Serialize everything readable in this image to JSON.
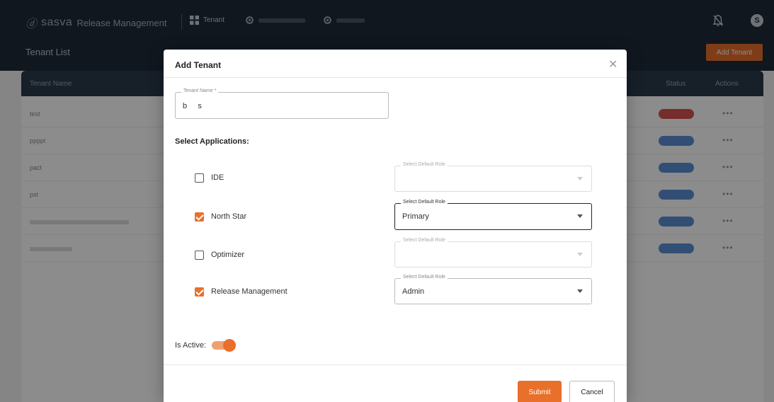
{
  "nav": {
    "brand_logo": "ⓓ",
    "brand_name": "sasva",
    "brand_product": "Release Management",
    "tabs": [
      {
        "label": "Tenant",
        "icon": "grid-icon"
      },
      {
        "label": "",
        "icon": "gear-icon"
      },
      {
        "label": "",
        "icon": "gear-icon"
      }
    ],
    "bell_icon": "bell-off-icon",
    "avatar_initial": "S"
  },
  "page": {
    "title": "Tenant List",
    "add_button": "Add Tenant"
  },
  "table": {
    "columns": [
      "Tenant Name",
      "Status",
      "Actions"
    ],
    "rows": [
      {
        "name": "test",
        "status": "",
        "status_color": "#d9534f"
      },
      {
        "name": "ppppl",
        "status": "",
        "status_color": "#5b8fd6"
      },
      {
        "name": "pact",
        "status": "",
        "status_color": "#5b8fd6"
      },
      {
        "name": "pst",
        "status": "",
        "status_color": "#5b8fd6"
      },
      {
        "name": "",
        "status": "",
        "status_color": "#5b8fd6"
      },
      {
        "name": "",
        "status": "",
        "status_color": "#5b8fd6"
      }
    ],
    "actions_glyph": "•••"
  },
  "modal": {
    "title": "Add Tenant",
    "close_glyph": "✕",
    "tenant_name_label": "Tenant Name *",
    "tenant_name_value": "b     s",
    "select_applications_label": "Select Applications:",
    "apps": [
      {
        "label": "IDE",
        "checked": false,
        "role_label": "Select Default Role",
        "role_value": "",
        "disabled": true
      },
      {
        "label": "North Star",
        "checked": true,
        "role_label": "Select Default Role",
        "role_value": "Primary",
        "disabled": false
      },
      {
        "label": "Optimizer",
        "checked": false,
        "role_label": "Select Default Role",
        "role_value": "",
        "disabled": true
      },
      {
        "label": "Release Management",
        "checked": true,
        "role_label": "Select Default Role",
        "role_value": "Admin",
        "disabled": false
      }
    ],
    "is_active_label": "Is Active:",
    "is_active": true,
    "submit_label": "Submit",
    "cancel_label": "Cancel"
  },
  "colors": {
    "accent": "#e8702a",
    "nav_bg": "#1e2a3a"
  }
}
